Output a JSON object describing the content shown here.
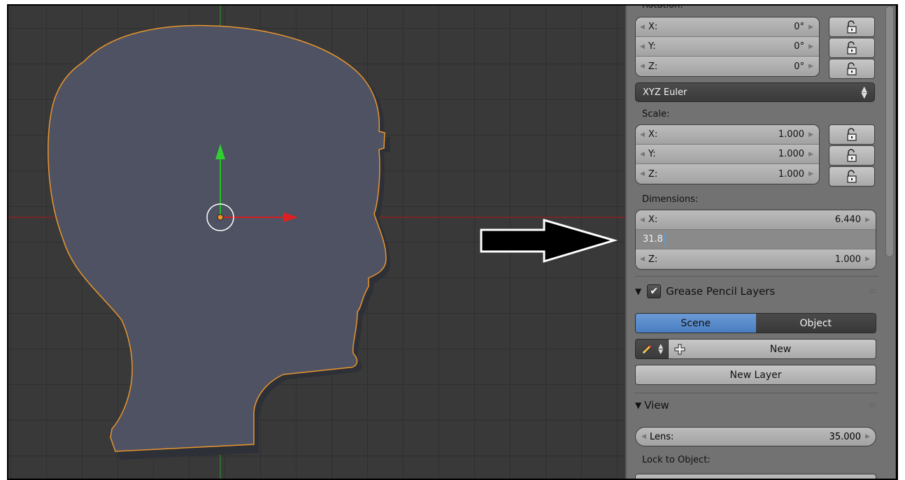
{
  "rotation": {
    "label": "Rotation:",
    "fields": [
      {
        "axis": "X:",
        "value": "0°"
      },
      {
        "axis": "Y:",
        "value": "0°"
      },
      {
        "axis": "Z:",
        "value": "0°"
      }
    ]
  },
  "rotation_mode": {
    "selected": "XYZ Euler"
  },
  "scale": {
    "label": "Scale:",
    "fields": [
      {
        "axis": "X:",
        "value": "1.000"
      },
      {
        "axis": "Y:",
        "value": "1.000"
      },
      {
        "axis": "Z:",
        "value": "1.000"
      }
    ]
  },
  "dimensions": {
    "label": "Dimensions:",
    "x": {
      "axis": "X:",
      "value": "6.440"
    },
    "y_editing": "31.8",
    "z": {
      "axis": "Z:",
      "value": "1.000"
    }
  },
  "grease_pencil": {
    "title": "Grease Pencil Layers",
    "tab_scene": "Scene",
    "tab_object": "Object",
    "new_label": "New",
    "new_layer_label": "New Layer"
  },
  "view": {
    "title": "View",
    "lens_label": "Lens:",
    "lens_value": "35.000",
    "lock_to_object": "Lock to Object:"
  },
  "icons": [
    "lock-icon",
    "pencil-icon",
    "plus-icon",
    "checkbox-icon",
    "arrow-right-icon",
    "transform-gizmo-icon"
  ],
  "colors": {
    "viewport_bg": "#393939",
    "mesh_fill": "#4f5263",
    "selection_outline": "#e8962c",
    "x_axis": "#d22020",
    "y_axis": "#20c020",
    "scene_tab_active": "#5a8ccc"
  }
}
